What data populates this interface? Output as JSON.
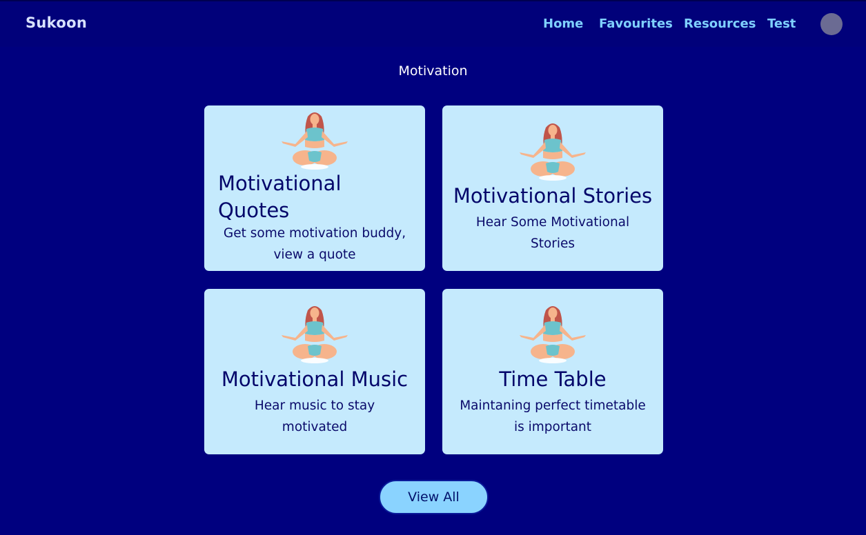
{
  "header": {
    "brand": "Sukoon",
    "nav": [
      "Home",
      "Favourites",
      "Resources",
      "Test"
    ]
  },
  "page": {
    "title": "Motivation"
  },
  "cards": [
    {
      "title": "Motivational Quotes",
      "desc": "Get some motivation buddy, view a quote"
    },
    {
      "title": "Motivational Stories",
      "desc": "Hear Some Motivational Stories"
    },
    {
      "title": "Motivational Music",
      "desc": "Hear music to stay motivated"
    },
    {
      "title": "Time Table",
      "desc": "Maintaning perfect timetable is important"
    }
  ],
  "view_all_label": "View All",
  "icons": {
    "card_image": "meditating-woman-icon",
    "profile": "avatar"
  },
  "colors": {
    "background": "#00007f",
    "card": "#c5eafd",
    "nav_link": "#7fd0ff",
    "button": "#8ad3ff"
  }
}
